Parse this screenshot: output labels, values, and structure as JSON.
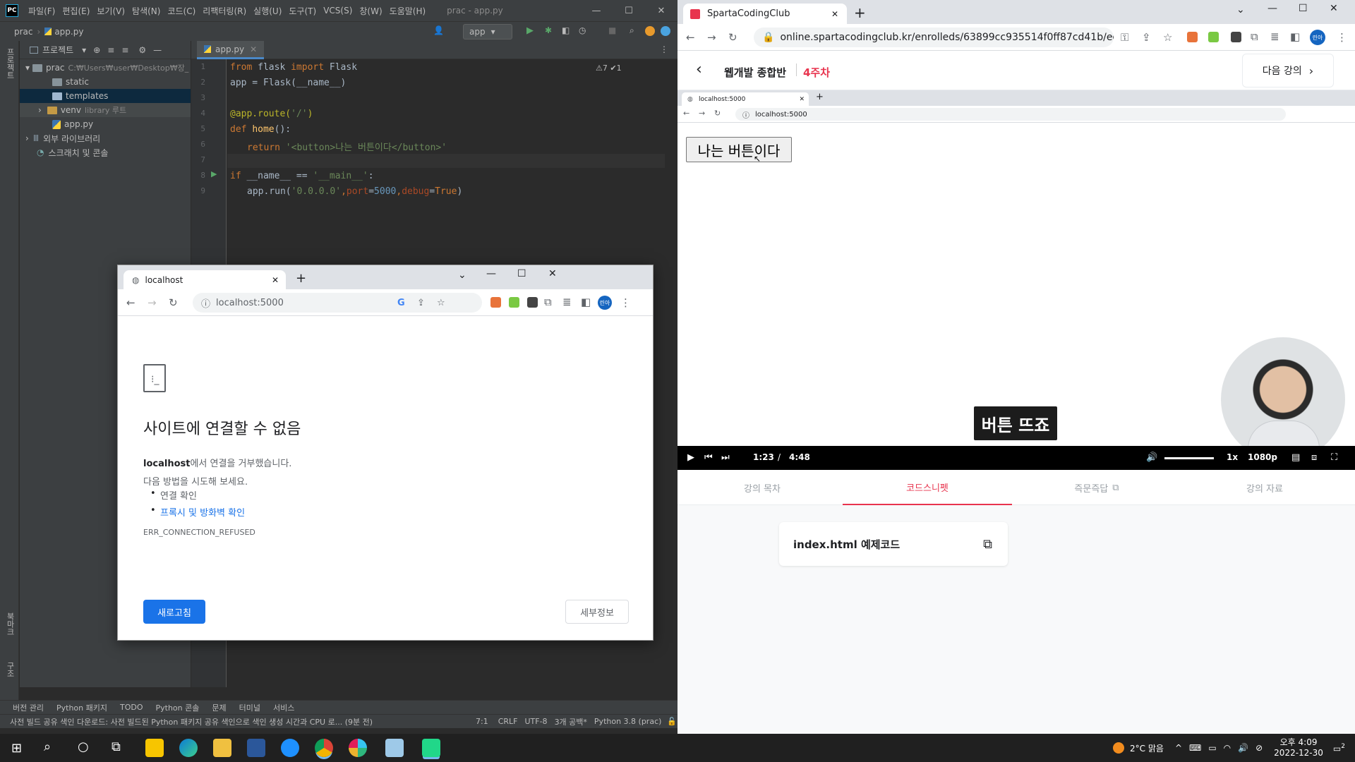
{
  "ide": {
    "logo": "PC",
    "menu": [
      "파일(F)",
      "편집(E)",
      "보기(V)",
      "탐색(N)",
      "코드(C)",
      "리팩터링(R)",
      "실행(U)",
      "도구(T)",
      "VCS(S)",
      "창(W)",
      "도움말(H)"
    ],
    "window_title": "prac - app.py",
    "breadcrumb_project": "prac",
    "breadcrumb_file": "app.py",
    "run_config": "app",
    "project_label": "프로젝트",
    "tree": [
      {
        "label": "prac",
        "extra": "C:₩Users₩user₩Desktop₩장_",
        "type": "folder"
      },
      {
        "label": "static",
        "type": "folder"
      },
      {
        "label": "templates",
        "type": "folder"
      },
      {
        "label": "venv",
        "extra": "library 루트",
        "type": "folder"
      },
      {
        "label": "app.py",
        "type": "py"
      },
      {
        "label": "외부 라이브러리",
        "type": "lib"
      },
      {
        "label": "스크래치 및 콘솔",
        "type": "scratch"
      }
    ],
    "editor_tab": "app.py",
    "inspections": "⚠7 ✔1",
    "code": {
      "l1_a": "from",
      "l1_b": " flask ",
      "l1_c": "import",
      "l1_d": " Flask",
      "l2": "app = Flask(__name__)",
      "l4_dec": "@app.route(",
      "l4_str": "'/'",
      "l4_end": ")",
      "l5_kw": "def ",
      "l5_fn": "home",
      "l5_end": "():",
      "l6_kw": "return ",
      "l6_str": "'<button>나는 버튼이다</button>'",
      "l8_kw": "if ",
      "l8_a": "__name__ == ",
      "l8_str": "'__main__'",
      "l8_end": ":",
      "l9_a": "app.run(",
      "l9_str": "'0.0.0.0'",
      "l9_b": ",",
      "l9_p1": "port",
      "l9_c": "=",
      "l9_n": "5000",
      "l9_d": ",",
      "l9_p2": "debug",
      "l9_e": "=",
      "l9_kw": "True",
      "l9_f": ")"
    },
    "line_numbers": [
      "1",
      "2",
      "3",
      "4",
      "5",
      "6",
      "7",
      "8",
      "9"
    ],
    "left_strip": {
      "top": "프로젝트",
      "bottom1": "북마크",
      "bottom2": "구조"
    },
    "bottom_tabs": [
      "버전 관리",
      "Python 패키지",
      "TODO",
      "Python 콘솔",
      "문제",
      "터미널",
      "서비스"
    ],
    "status": {
      "message": "사전 빌드 공유 색인 다운로드: 사전 빌드된 Python 패키지 공유 색인으로 색인 생성 시간과 CPU 로... (9분 전)",
      "pos": "7:1",
      "eol": "CRLF",
      "enc": "UTF-8",
      "indent": "3개 공백*",
      "interp": "Python 3.8 (prac)"
    }
  },
  "popup": {
    "tab_title": "localhost",
    "url": "localhost:5000",
    "profile": "린아",
    "title": "사이트에 연결할 수 없음",
    "host": "localhost",
    "refused": "에서 연결을 거부했습니다.",
    "try": "다음 방법을 시도해 보세요.",
    "bullet1": "연결 확인",
    "bullet2": "프록시 및 방화벽 확인",
    "code": "ERR_CONNECTION_REFUSED",
    "reload": "새로고침",
    "details": "세부정보"
  },
  "right": {
    "tab_title": "SpartaCodingClub",
    "url": "online.spartacodingclub.kr/enrolleds/63899cc935514f0ff87cd41b/ede...",
    "profile": "린아",
    "course": "웹개발 종합반",
    "week": "4주차",
    "next": "다음 강의",
    "inner_tab": "localhost:5000",
    "inner_url": "localhost:5000",
    "demo_button": "나는 버튼이다",
    "subtitle": "버튼 뜨죠",
    "time_current": "1:23",
    "time_sep": "/",
    "time_total": "4:48",
    "progress": 0.288,
    "buffered": 0.51,
    "speed": "1x",
    "quality": "1080p",
    "tabs": [
      "강의 목차",
      "코드스니펫",
      "즉문즉답",
      "강의 자료"
    ],
    "active_tab": 1,
    "snippet": "index.html 예제코드",
    "accent": "#e8344e"
  },
  "taskbar": {
    "weather": "2°C 맑음",
    "time": "오후 4:09",
    "date": "2022-12-30",
    "notif": "2"
  }
}
